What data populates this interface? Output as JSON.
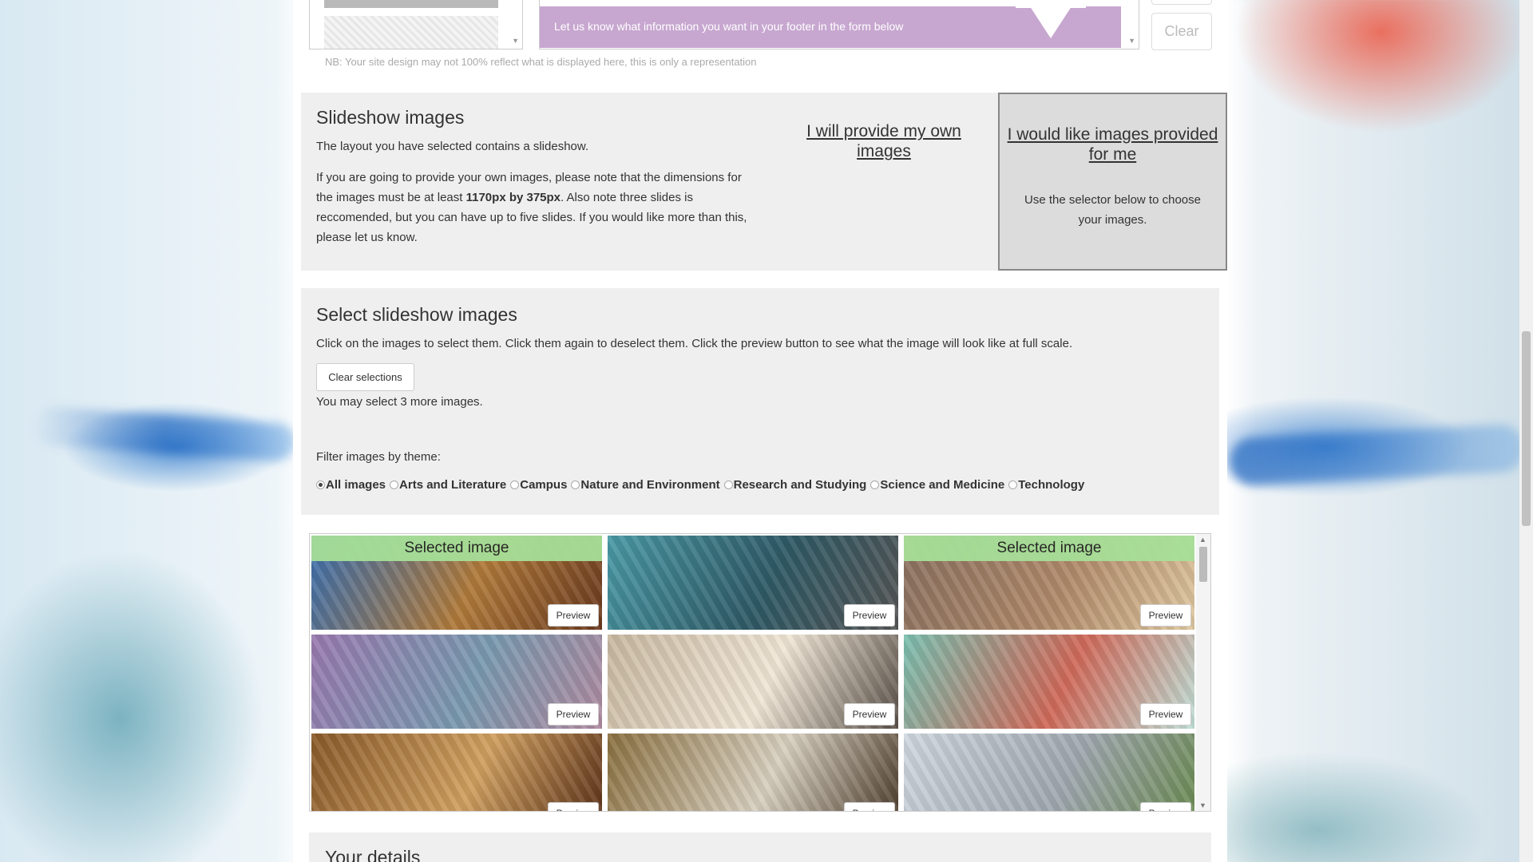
{
  "top_strip": {
    "footer_preview_text": "Let us know what information you want in your footer in the form below",
    "clear_label": "Clear",
    "note": "NB: Your site design may not 100% reflect what is displayed here, this is only a representation"
  },
  "slideshow": {
    "title": "Slideshow images",
    "intro": "The layout you have selected contains a slideshow.",
    "para_before": "If you are going to provide your own images, please note that the dimensions for the images must be at least ",
    "para_bold": "1170px by 375px",
    "para_after": ". Also note three slides is reccomended, but you can have up to five slides. If you would like more than this, please let us know.",
    "option_own": "I will provide my own images",
    "option_provided": "I would like images provided for me",
    "option_provided_desc": "Use the selector below to choose your images."
  },
  "select": {
    "title": "Select slideshow images",
    "instructions": "Click on the images to select them. Click them again to deselect them. Click the preview button to see what the image will look like at full scale.",
    "clear_selections_label": "Clear selections",
    "remaining_text": "You may select 3 more images.",
    "filter_label": "Filter images by theme:",
    "filters": [
      {
        "label": "All images",
        "checked": true
      },
      {
        "label": "Arts and Literature",
        "checked": false
      },
      {
        "label": "Campus",
        "checked": false
      },
      {
        "label": "Nature and Environment",
        "checked": false
      },
      {
        "label": "Research and Studying",
        "checked": false
      },
      {
        "label": "Science and Medicine",
        "checked": false
      },
      {
        "label": "Technology",
        "checked": false
      }
    ]
  },
  "grid": {
    "selected_label": "Selected image",
    "preview_label": "Preview",
    "tiles": [
      {
        "name": "paintbrush-books",
        "selected": true,
        "colors": [
          "#3a6fb0",
          "#b07a3a",
          "#6b3a1f"
        ]
      },
      {
        "name": "ballet-dancers",
        "selected": false,
        "colors": [
          "#4a9aa6",
          "#2f5a66",
          "#555555"
        ]
      },
      {
        "name": "statue-quill",
        "selected": true,
        "colors": [
          "#8a7060",
          "#b08a6a",
          "#e0c8a0"
        ]
      },
      {
        "name": "damask-pattern",
        "selected": false,
        "colors": [
          "#9a7ab0",
          "#7a9ab0",
          "#b08aa0"
        ]
      },
      {
        "name": "open-book",
        "selected": false,
        "colors": [
          "#c8b8a0",
          "#f0e6d6",
          "#5a5048"
        ]
      },
      {
        "name": "mosaic-tiles",
        "selected": false,
        "colors": [
          "#7ac0b0",
          "#d06a5a",
          "#bfe0d8"
        ]
      },
      {
        "name": "theatre-interior",
        "selected": false,
        "colors": [
          "#8a5a2a",
          "#d0a060",
          "#5a3018"
        ]
      },
      {
        "name": "students-laptop",
        "selected": false,
        "colors": [
          "#8a7040",
          "#d8d0c0",
          "#4a3a2a"
        ]
      },
      {
        "name": "campus-building",
        "selected": false,
        "colors": [
          "#d0d8e0",
          "#a0a8b0",
          "#6a8a50"
        ]
      }
    ]
  },
  "details": {
    "title": "Your details"
  }
}
